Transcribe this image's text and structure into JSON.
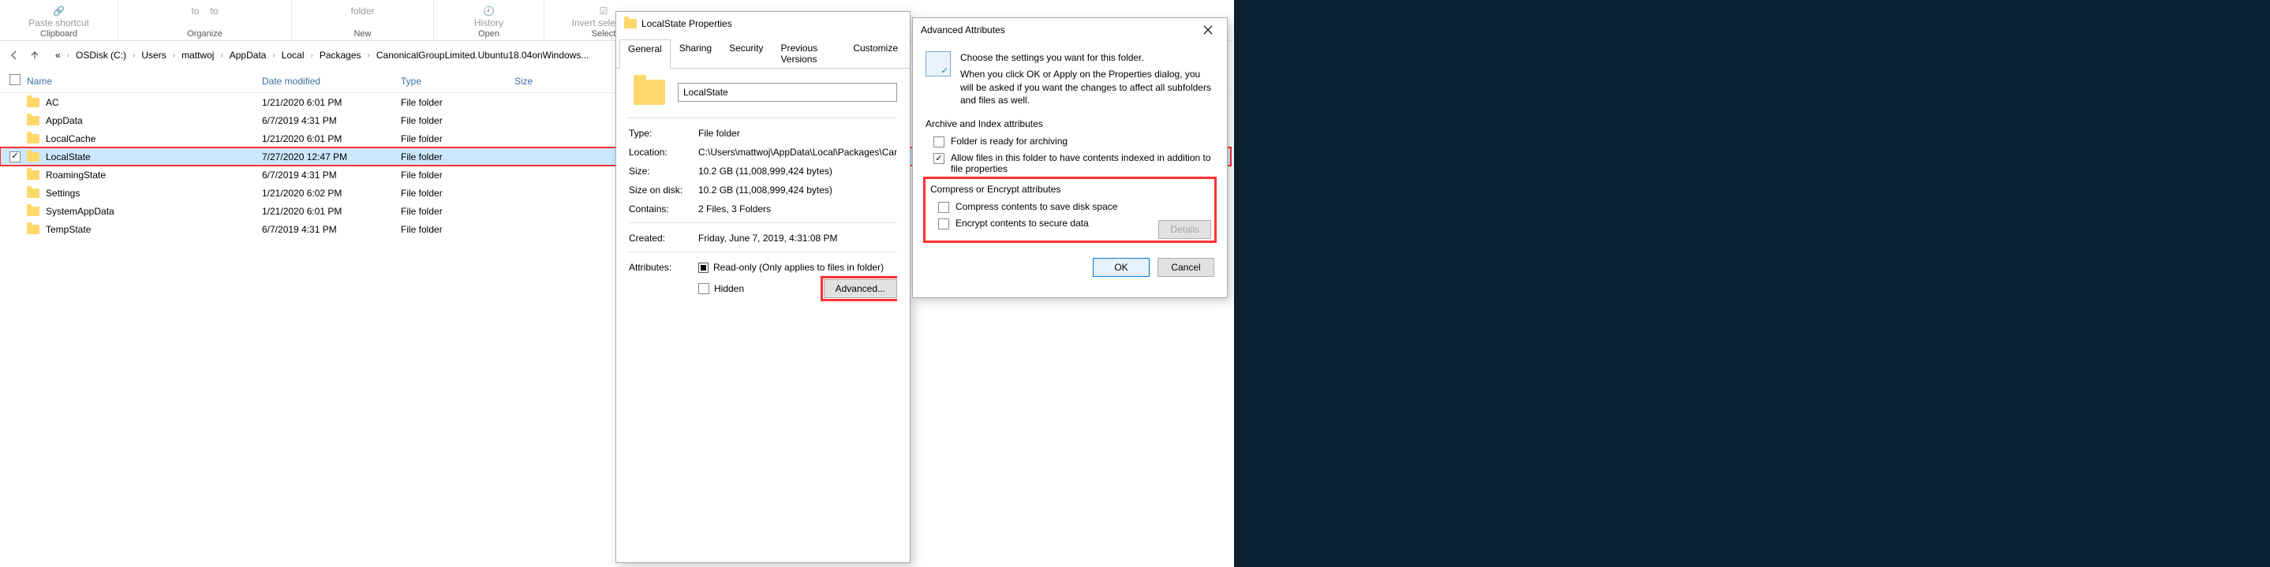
{
  "ribbon": {
    "paste_shortcut": "Paste shortcut",
    "move_to": "to",
    "copy_to": "to",
    "folder": "folder",
    "history": "History",
    "invert_selection": "Invert selection",
    "groups": {
      "clipboard": "Clipboard",
      "organize": "Organize",
      "new": "New",
      "open": "Open",
      "select": "Select"
    }
  },
  "breadcrumb": {
    "items": [
      "«",
      "OSDisk (C:)",
      "Users",
      "mattwoj",
      "AppData",
      "Local",
      "Packages",
      "CanonicalGroupLimited.Ubuntu18.04onWindows..."
    ]
  },
  "columns": {
    "name": "Name",
    "date": "Date modified",
    "type": "Type",
    "size": "Size"
  },
  "rows": [
    {
      "name": "AC",
      "date": "1/21/2020 6:01 PM",
      "type": "File folder",
      "selected": false
    },
    {
      "name": "AppData",
      "date": "6/7/2019 4:31 PM",
      "type": "File folder",
      "selected": false
    },
    {
      "name": "LocalCache",
      "date": "1/21/2020 6:01 PM",
      "type": "File folder",
      "selected": false
    },
    {
      "name": "LocalState",
      "date": "7/27/2020 12:47 PM",
      "type": "File folder",
      "selected": true
    },
    {
      "name": "RoamingState",
      "date": "6/7/2019 4:31 PM",
      "type": "File folder",
      "selected": false
    },
    {
      "name": "Settings",
      "date": "1/21/2020 6:02 PM",
      "type": "File folder",
      "selected": false
    },
    {
      "name": "SystemAppData",
      "date": "1/21/2020 6:01 PM",
      "type": "File folder",
      "selected": false
    },
    {
      "name": "TempState",
      "date": "6/7/2019 4:31 PM",
      "type": "File folder",
      "selected": false
    }
  ],
  "properties": {
    "title": "LocalState Properties",
    "tabs": [
      "General",
      "Sharing",
      "Security",
      "Previous Versions",
      "Customize"
    ],
    "name_value": "LocalState",
    "type_label": "Type:",
    "type_value": "File folder",
    "location_label": "Location:",
    "location_value": "C:\\Users\\mattwoj\\AppData\\Local\\Packages\\Canonic",
    "size_label": "Size:",
    "size_value": "10.2 GB (11,008,999,424 bytes)",
    "sod_label": "Size on disk:",
    "sod_value": "10.2 GB (11,008,999,424 bytes)",
    "contains_label": "Contains:",
    "contains_value": "2 Files, 3 Folders",
    "created_label": "Created:",
    "created_value": "Friday, June 7, 2019, 4:31:08 PM",
    "attributes_label": "Attributes:",
    "readonly_text": "Read-only (Only applies to files in folder)",
    "hidden_text": "Hidden",
    "advanced_btn": "Advanced..."
  },
  "advanced": {
    "title": "Advanced Attributes",
    "intro1": "Choose the settings you want for this folder.",
    "intro2": "When you click OK or Apply on the Properties dialog, you will be asked if you want the changes to affect all subfolders and files as well.",
    "archive_group": "Archive and Index attributes",
    "archive_ready": "Folder is ready for archiving",
    "index_text": "Allow files in this folder to have contents indexed in addition to file properties",
    "encrypt_group": "Compress or Encrypt attributes",
    "compress_text": "Compress contents to save disk space",
    "encrypt_text": "Encrypt contents to secure data",
    "details_btn": "Details",
    "ok_btn": "OK",
    "cancel_btn": "Cancel"
  }
}
